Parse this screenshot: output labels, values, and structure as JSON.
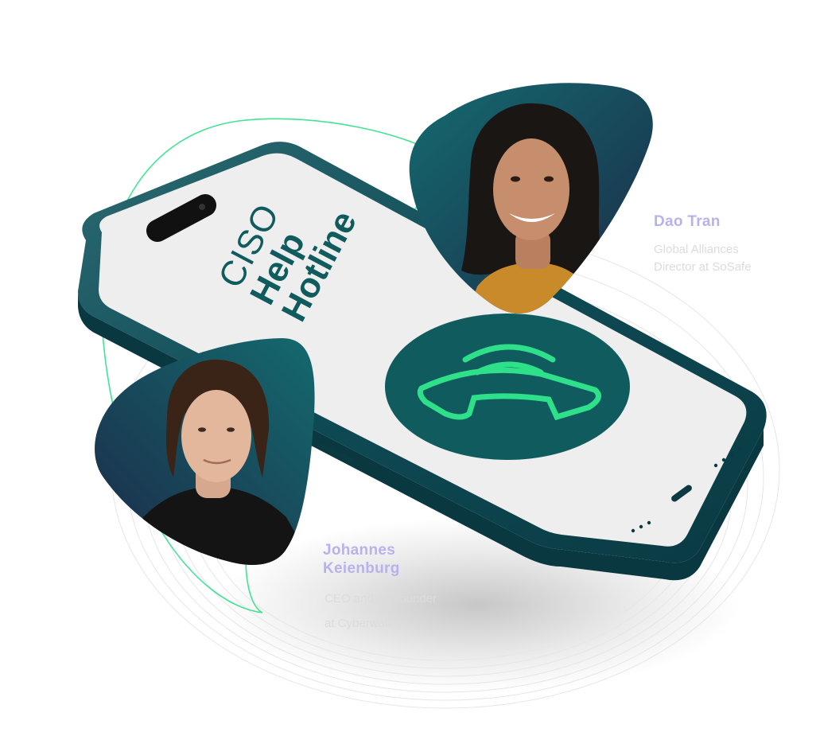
{
  "hero": {
    "screen_title": {
      "line1": "CISO",
      "line2": "Help",
      "line3": "Hotline"
    },
    "call_icon": "phone-handset-icon"
  },
  "speakers": [
    {
      "name": "Dao Tran",
      "role_line1": "Global Alliances",
      "role_line2": "Director at SoSafe"
    },
    {
      "name_line1": "Johannes",
      "name_line2": "Keienburg",
      "role_line1": "CEO and Co-founder",
      "role_line2": "at Cyberwalk"
    }
  ],
  "colors": {
    "teal_dark": "#0f5b5e",
    "teal_phone": "#0e4a54",
    "navy": "#1b2f4a",
    "accent_green": "#2fe08a",
    "name_lavender": "#b8b2ec",
    "screen_bg": "#eeeeee"
  }
}
